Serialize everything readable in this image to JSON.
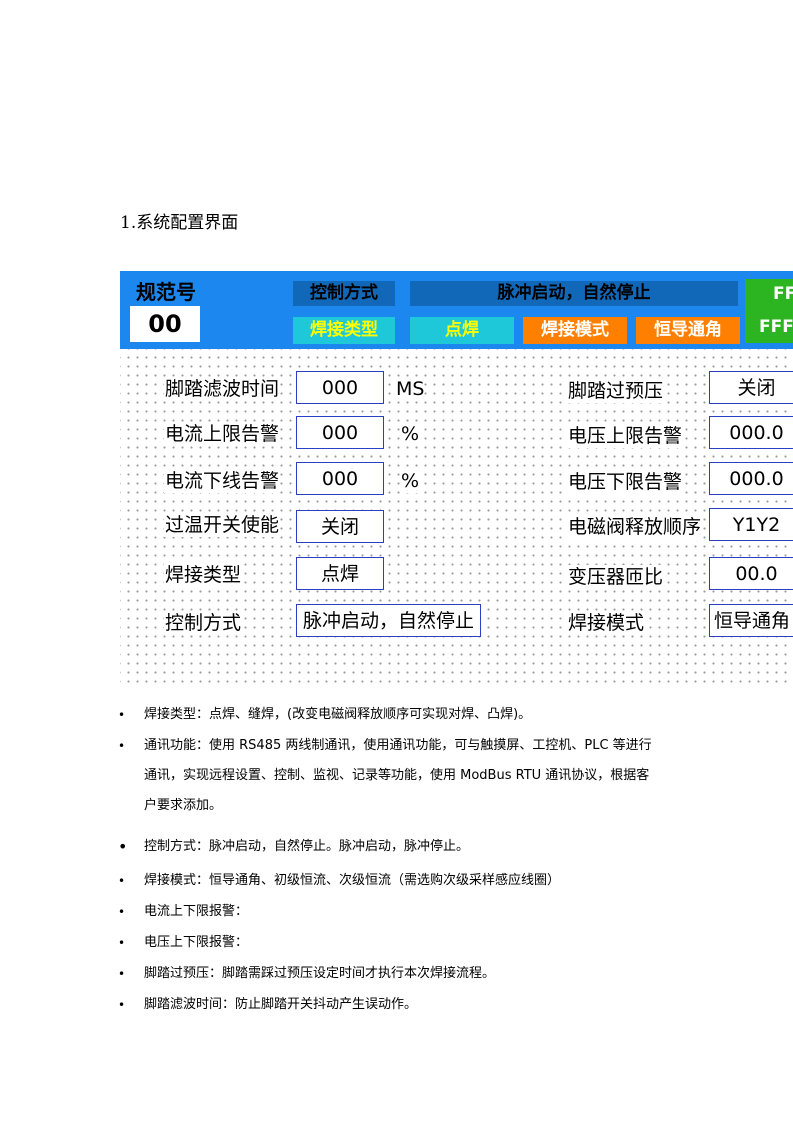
{
  "section_title": "1.系统配置界面",
  "topbar": {
    "code_label": "规范号",
    "code_value": "00",
    "control_mode_label": "控制方式",
    "control_mode_value": "脉冲启动，自然停止",
    "weld_type_label": "焊接类型",
    "weld_type_value": "点焊",
    "weld_mode_label": "焊接模式",
    "weld_mode_value": "恒导通角",
    "green_top": "FF",
    "green_bottom": "FFF"
  },
  "form": {
    "left": [
      {
        "label": "脚踏滤波时间",
        "value": "000",
        "unit": "MS"
      },
      {
        "label": "电流上限告警",
        "value": "000",
        "unit": "%"
      },
      {
        "label": "电流下线告警",
        "value": "000",
        "unit": "%"
      },
      {
        "label": "过温开关使能",
        "value": "关闭",
        "unit": ""
      },
      {
        "label": "焊接类型",
        "value": "点焊",
        "unit": ""
      },
      {
        "label": "控制方式",
        "value": "脉冲启动，自然停止",
        "unit": ""
      }
    ],
    "right": [
      {
        "label": "脚踏过预压",
        "value": "关闭"
      },
      {
        "label": "电压上限告警",
        "value": "000.0"
      },
      {
        "label": "电压下限告警",
        "value": "000.0"
      },
      {
        "label": "电磁阀释放顺序",
        "value": "Y1Y2"
      },
      {
        "label": "变压器匝比",
        "value": "00.0"
      },
      {
        "label": "焊接模式",
        "value": "恒导通角"
      }
    ]
  },
  "bullets": {
    "marker": "•",
    "b1": "焊接类型：点焊、缝焊，(改变电磁阀释放顺序可实现对焊、凸焊)。",
    "b2_line1": "通讯功能：使用 RS485 两线制通讯，使用通讯功能，可与触摸屏、工控机、PLC 等进行",
    "b2_line2": "通讯，实现远程设置、控制、监视、记录等功能，使用 ModBus RTU 通讯协议，根据客",
    "b2_line3": "户要求添加。",
    "b3": "控制方式：脉冲启动，自然停止。脉冲启动，脉冲停止。",
    "b4": "焊接模式：恒导通角、初级恒流、次级恒流（需选购次级采样感应线圈）",
    "b5": "电流上下限报警：",
    "b6": "电压上下限报警：",
    "b7": "脚踏过预压：脚踏需踩过预压设定时间才执行本次焊接流程。",
    "b8": "脚踏滤波时间：防止脚踏开关抖动产生误动作。"
  }
}
